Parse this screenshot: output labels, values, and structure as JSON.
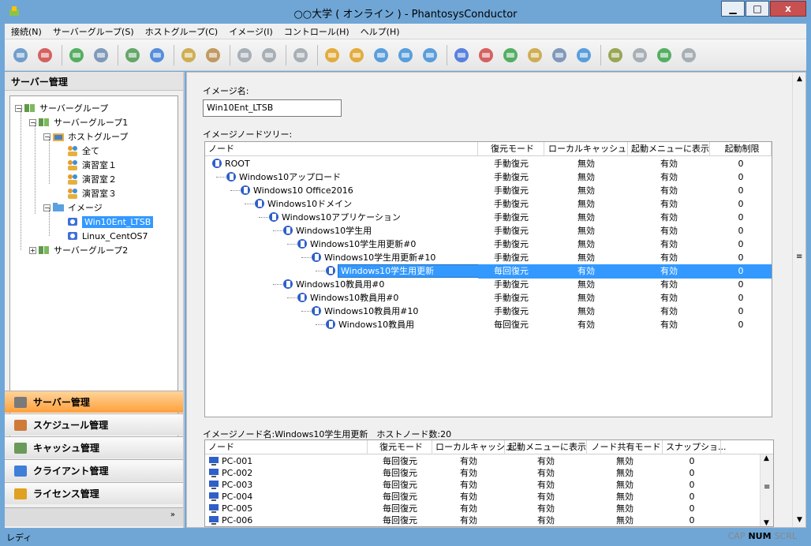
{
  "window": {
    "title": "○○大学 ( オンライン ) - PhantosysConductor",
    "minimize": "▁",
    "maximize": "□",
    "close": "x"
  },
  "menu": [
    "接続(N)",
    "サーバーグループ(S)",
    "ホストグループ(C)",
    "イメージ(I)",
    "コントロール(H)",
    "ヘルプ(H)"
  ],
  "left_pane": {
    "header": "サーバー管理",
    "tree": [
      {
        "label": "サーバーグループ",
        "level": 0,
        "expander": "−"
      },
      {
        "label": "サーバーグループ1",
        "level": 1,
        "expander": "−"
      },
      {
        "label": "ホストグループ",
        "level": 2,
        "expander": "−"
      },
      {
        "label": "全て",
        "level": 3,
        "expander": ""
      },
      {
        "label": "演習室１",
        "level": 3,
        "expander": ""
      },
      {
        "label": "演習室２",
        "level": 3,
        "expander": ""
      },
      {
        "label": "演習室３",
        "level": 3,
        "expander": ""
      },
      {
        "label": "イメージ",
        "level": 2,
        "expander": "−"
      },
      {
        "label": "Win10Ent_LTSB",
        "level": 3,
        "expander": "",
        "selected": true
      },
      {
        "label": "Linux_CentOS7",
        "level": 3,
        "expander": ""
      },
      {
        "label": "サーバーグループ2",
        "level": 1,
        "expander": "+"
      }
    ],
    "nav": [
      "サーバー管理",
      "スケジュール管理",
      "キャッシュ管理",
      "クライアント管理",
      "ライセンス管理"
    ],
    "more": "»"
  },
  "right_pane": {
    "image_name_label": "イメージ名:",
    "image_name_value": "Win10Ent_LTSB",
    "tree_label": "イメージノードツリー:",
    "node_columns": [
      "ノード",
      "復元モード",
      "ローカルキャッシュ",
      "起動メニューに表示",
      "起動制限"
    ],
    "nodes": [
      {
        "name": "ROOT",
        "depth": 0,
        "mode": "手動復元",
        "cache": "無効",
        "menu": "有効",
        "limit": "0"
      },
      {
        "name": "Windows10アップロード",
        "depth": 1,
        "mode": "手動復元",
        "cache": "無効",
        "menu": "有効",
        "limit": "0"
      },
      {
        "name": "Windows10 Office2016",
        "depth": 2,
        "mode": "手動復元",
        "cache": "無効",
        "menu": "有効",
        "limit": "0"
      },
      {
        "name": "Windows10ドメイン",
        "depth": 3,
        "mode": "手動復元",
        "cache": "無効",
        "menu": "有効",
        "limit": "0"
      },
      {
        "name": "Windows10アプリケーション",
        "depth": 4,
        "mode": "手動復元",
        "cache": "無効",
        "menu": "有効",
        "limit": "0"
      },
      {
        "name": "Windows10学生用",
        "depth": 5,
        "mode": "手動復元",
        "cache": "無効",
        "menu": "有効",
        "limit": "0"
      },
      {
        "name": "Windows10学生用更新#0",
        "depth": 6,
        "mode": "手動復元",
        "cache": "無効",
        "menu": "有効",
        "limit": "0"
      },
      {
        "name": "Windows10学生用更新#10",
        "depth": 7,
        "mode": "手動復元",
        "cache": "無効",
        "menu": "有効",
        "limit": "0"
      },
      {
        "name": "Windows10学生用更新",
        "depth": 8,
        "mode": "毎回復元",
        "cache": "有効",
        "menu": "有効",
        "limit": "0",
        "selected": true
      },
      {
        "name": "Windows10教員用#0",
        "depth": 5,
        "mode": "手動復元",
        "cache": "無効",
        "menu": "有効",
        "limit": "0"
      },
      {
        "name": "Windows10教員用#0",
        "depth": 6,
        "mode": "手動復元",
        "cache": "無効",
        "menu": "有効",
        "limit": "0"
      },
      {
        "name": "Windows10教員用#10",
        "depth": 7,
        "mode": "手動復元",
        "cache": "無効",
        "menu": "有効",
        "limit": "0"
      },
      {
        "name": "Windows10教員用",
        "depth": 8,
        "mode": "毎回復元",
        "cache": "有効",
        "menu": "有効",
        "limit": "0"
      }
    ],
    "node_info": "イメージノード名:Windows10学生用更新　ホストノード数:20",
    "host_columns": [
      "ノード",
      "復元モード",
      "ローカルキャッシュ",
      "起動メニューに表示",
      "ノード共有モード",
      "スナップショ..."
    ],
    "hosts": [
      {
        "name": "PC-001",
        "mode": "毎回復元",
        "cache": "有効",
        "menu": "有効",
        "share": "無効",
        "snap": "0"
      },
      {
        "name": "PC-002",
        "mode": "毎回復元",
        "cache": "有効",
        "menu": "有効",
        "share": "無効",
        "snap": "0"
      },
      {
        "name": "PC-003",
        "mode": "毎回復元",
        "cache": "有効",
        "menu": "有効",
        "share": "無効",
        "snap": "0"
      },
      {
        "name": "PC-004",
        "mode": "毎回復元",
        "cache": "有効",
        "menu": "有効",
        "share": "無効",
        "snap": "0"
      },
      {
        "name": "PC-005",
        "mode": "毎回復元",
        "cache": "有効",
        "menu": "有効",
        "share": "無効",
        "snap": "0"
      },
      {
        "name": "PC-006",
        "mode": "毎回復元",
        "cache": "有効",
        "menu": "有効",
        "share": "無効",
        "snap": "0"
      }
    ]
  },
  "status": {
    "text": "レディ",
    "keys": [
      "CAP",
      "NUM",
      "SCRL"
    ],
    "active_key": "NUM"
  },
  "colors": {
    "titlebar": "#6fa6d6",
    "selection": "#3399ff",
    "nav_active": "#ff9f3b"
  }
}
